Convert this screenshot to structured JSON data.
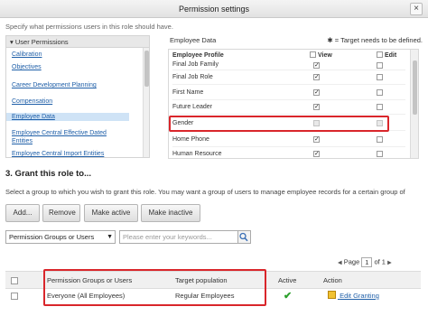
{
  "window": {
    "title": "Permission settings",
    "close_label": "×"
  },
  "specify_text": "Specify what permissions users in this role should have.",
  "tree": {
    "header": "User Permissions",
    "items": [
      "Calibration",
      "Objectives",
      "Career Development Planning",
      "Compensation",
      "Employee Data",
      "Employee Central Effective Dated Entities",
      "Employee Central Import Entities"
    ],
    "selected": "Employee Data"
  },
  "grid": {
    "title": "Employee Data",
    "note": "= Target needs to be defined.",
    "columns": {
      "profile": "Employee Profile",
      "view": "View",
      "edit": "Edit"
    },
    "rows": [
      {
        "label": "Final Job Family",
        "view": true,
        "edit": false
      },
      {
        "label": "Final Job Role",
        "view": true,
        "edit": false
      },
      {
        "label": "First Name",
        "view": true,
        "edit": false
      },
      {
        "label": "Future Leader",
        "view": true,
        "edit": false
      },
      {
        "label": "Gender",
        "view": false,
        "edit": false
      },
      {
        "label": "Home Phone",
        "view": true,
        "edit": false
      },
      {
        "label": "Human Resource",
        "view": true,
        "edit": false
      }
    ]
  },
  "grant": {
    "title": "3. Grant this role to...",
    "description": "Select a group to which you wish to grant this role. You may want a group of users to manage employee records for a certain group of",
    "buttons": {
      "add": "Add...",
      "remove": "Remove",
      "make_active": "Make active",
      "make_inactive": "Make inactive"
    },
    "filter_select": "Permission Groups or Users",
    "search_placeholder": "Please enter your keywords...",
    "pager": {
      "page_label": "Page",
      "current": "1",
      "of_label": "of",
      "total": "1"
    },
    "table": {
      "headers": {
        "group": "Permission Groups or Users",
        "target": "Target population",
        "active": "Active",
        "action": "Action"
      },
      "rows": [
        {
          "group": "Everyone (All Employees)",
          "target": "Regular Employees",
          "active": true,
          "action": "Edit Granting"
        }
      ]
    }
  },
  "colors": {
    "highlight": "#d9262b",
    "link": "#1f5fa8",
    "active_check": "#2ca02c"
  }
}
